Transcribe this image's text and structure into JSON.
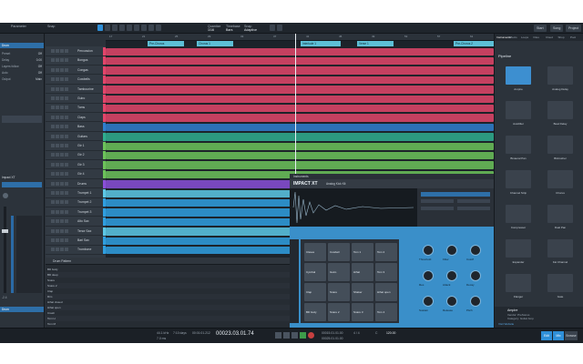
{
  "toolbar": {
    "left_fields": [
      "Parameter",
      "Snap"
    ],
    "mode_buttons": [
      "Start",
      "Song",
      "Project"
    ],
    "right_labels": [
      "Quantize",
      "Timebase",
      "Snap"
    ],
    "right_values": [
      "1/16",
      "Bars",
      "Adaptive"
    ]
  },
  "inspector": {
    "title": "Drum",
    "rows": [
      {
        "label": "Preset",
        "value": "Off"
      },
      {
        "label": "Delay",
        "value": "0.00"
      },
      {
        "label": "Layers follow",
        "value": "Off"
      },
      {
        "label": "Auto",
        "value": "Off"
      },
      {
        "label": "Output",
        "value": "Main"
      }
    ],
    "channel_name": "Impact XT",
    "bottom_label": "Drum",
    "fader_value": "-2.4"
  },
  "tracks": [
    {
      "name": "Percussion",
      "color": "#e3456a"
    },
    {
      "name": "Bongos",
      "color": "#e3456a"
    },
    {
      "name": "Congas",
      "color": "#e3456a"
    },
    {
      "name": "Cowbells",
      "color": "#e3456a"
    },
    {
      "name": "Tambourine",
      "color": "#e3456a"
    },
    {
      "name": "Guiro",
      "color": "#e3456a"
    },
    {
      "name": "Toms",
      "color": "#e3456a"
    },
    {
      "name": "Claps",
      "color": "#e3456a"
    },
    {
      "name": "Bass",
      "color": "#2f7fcf"
    },
    {
      "name": "Guitars",
      "color": "#2fae8f"
    },
    {
      "name": "Gtr 1",
      "color": "#6cc35a"
    },
    {
      "name": "Gtr 2",
      "color": "#6cc35a"
    },
    {
      "name": "Gtr 3",
      "color": "#6cc35a"
    },
    {
      "name": "Gtr 4",
      "color": "#6cc35a"
    },
    {
      "name": "Drums",
      "color": "#8a4fd8"
    },
    {
      "name": "Trumpet 1",
      "color": "#5cc8e6"
    },
    {
      "name": "Trumpet 2",
      "color": "#2f9fe0"
    },
    {
      "name": "Trumpet 3",
      "color": "#2f9fe0"
    },
    {
      "name": "Alto Sax",
      "color": "#2f9fe0"
    },
    {
      "name": "Tenor Sax",
      "color": "#5cc8e6"
    },
    {
      "name": "Bari Sax",
      "color": "#2f9fe0"
    },
    {
      "name": "Trombone",
      "color": "#2f9fe0"
    }
  ],
  "markers": [
    "Pre-Chorus",
    "Chorus 1",
    "Interlude 1",
    "Verse 1",
    "Pre-Chorus 2"
  ],
  "ruler_numbers": [
    "17",
    "21",
    "25",
    "29",
    "33",
    "37",
    "41",
    "45",
    "49",
    "53",
    "57",
    "61"
  ],
  "pattern_editor": {
    "title": "Drum Pattern",
    "rows": [
      "BD body",
      "BD deep",
      "Snare",
      "Snare 2",
      "Clap",
      "Rim",
      "Hihat closed",
      "Hihat open",
      "Crash",
      "Tom H",
      "Tom M"
    ]
  },
  "impact": {
    "title": "Instruments",
    "product": "IMPACT XT",
    "preset_label": "Analog Kick Kit",
    "pads": [
      "Claves",
      "Cowbell",
      "Tom 1",
      "Tom 2",
      "Cymbal",
      "Guiro",
      "Hihat",
      "Tom 3",
      "Clap",
      "Snare",
      "Shaker",
      "Hihat open",
      "BD body",
      "Snare 2",
      "Snare 3",
      "Tom 4"
    ],
    "knob_labels": [
      "Threshold",
      "Filter",
      "Cutoff",
      "Res",
      "Attack",
      "Decay",
      "Sustain",
      "Release",
      "Pitch"
    ]
  },
  "browser": {
    "tabs": [
      "Instruments",
      "Effects",
      "Loops",
      "Files",
      "Cloud",
      "Shop",
      "Pool"
    ],
    "category": "Pipeline",
    "items": [
      "Ampire",
      "Analog Delay",
      "Autofilter",
      "Beat Delay",
      "Binaural Pan",
      "Bitcrusher",
      "Channel Strip",
      "Chorus",
      "Compressor",
      "Dual Pan",
      "Expander",
      "Fat Channel",
      "Flanger",
      "Gate"
    ],
    "footer_title": "Ampire",
    "footer_sub": "Vendor: PreSonus",
    "footer_cat": "Category: Guitar Amp",
    "footer_link": "Visit Website"
  },
  "transport": {
    "sample_rate": "44.1 kHz",
    "latency": "7.0 ms",
    "record_time": "7:10 days",
    "time_sig": "4 / 4",
    "position": "00023.03.01.74",
    "second_time": "00:01:01.212",
    "loop_start": "00015.01.01.00",
    "loop_end": "00025.01.01.00",
    "tempo": "120.00",
    "key": "C",
    "buttons": [
      "Edit",
      "Mix",
      "Browse"
    ]
  }
}
